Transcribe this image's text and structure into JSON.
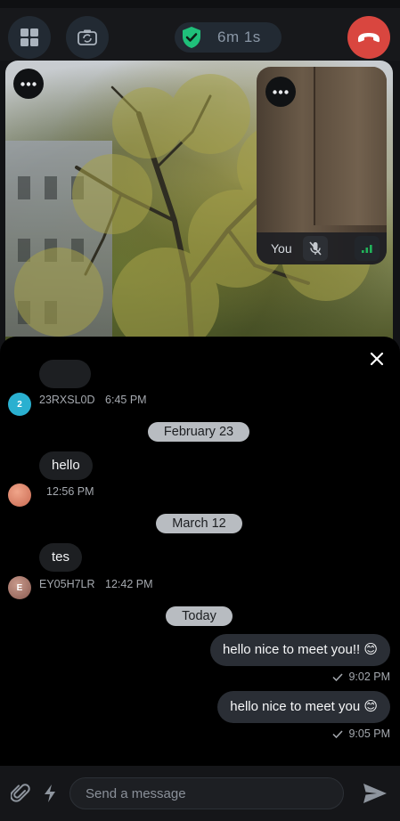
{
  "call": {
    "duration": "6m 1s"
  },
  "pip": {
    "self_label": "You"
  },
  "chat": {
    "entries": [
      {
        "avatar_letter": "2",
        "avatar_color": "#2ab0d0",
        "sender": "23RXSL0D",
        "time": "6:45 PM"
      },
      {
        "date": "February 23"
      },
      {
        "text": "hello",
        "time": "12:56 PM",
        "avatar_color": "#e2866a"
      },
      {
        "date": "March 12"
      },
      {
        "text": "tes",
        "avatar_letter": "E",
        "avatar_color": "#b07a6e",
        "sender": "EY05H7LR",
        "time": "12:42 PM"
      },
      {
        "date": "Today"
      },
      {
        "text": "hello nice to meet you!! 😊",
        "time": "9:02 PM"
      },
      {
        "text": "hello nice to meet you 😊",
        "time": "9:05 PM"
      }
    ]
  },
  "composer": {
    "placeholder": "Send a message"
  },
  "colors": {
    "hangup": "#d9463f",
    "shield": "#1fc07a",
    "signal": "#21b35a"
  }
}
